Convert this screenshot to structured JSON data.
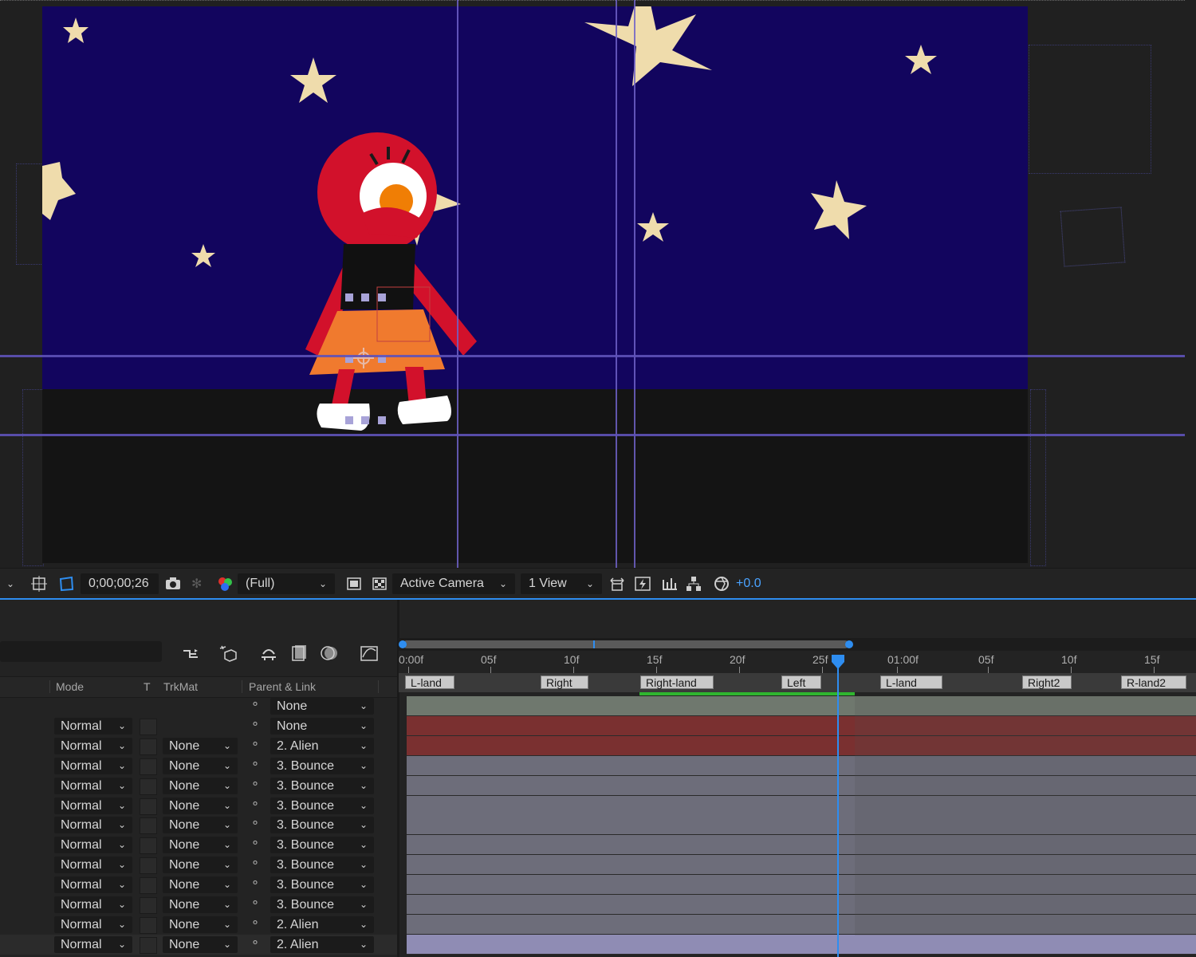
{
  "viewer": {
    "timecode": "0;00;00;26",
    "resolution": "(Full)",
    "camera": "Active Camera",
    "views": "1 View",
    "exposure": "+0.0",
    "colors": {
      "sky": "#12055e",
      "star": "#efdcac",
      "alien_body": "#d2112b",
      "skirt": "#f07a2e",
      "guide": "#6f62c8"
    },
    "toolbar_icons": [
      "chevron-down-icon",
      "region-of-interest-icon",
      "transparency-grid-icon",
      "snapshot-camera-icon",
      "show-snapshot-icon",
      "color-channels-icon",
      "fast-previews-icon",
      "toggle-mask-icon",
      "checkerboard-icon",
      "draft-3d-icon",
      "motion-blur-icon",
      "flowchart-icon",
      "reset-exposure-icon"
    ]
  },
  "timeline": {
    "columns": {
      "mode": "Mode",
      "t": "T",
      "trkmat": "TrkMat",
      "parent": "Parent & Link"
    },
    "tool_icons": [
      "shy-layers-icon",
      "comp-marker-icon",
      "frame-blending-icon",
      "draft-3d-icon",
      "motion-blur-icon",
      "graph-editor-icon"
    ],
    "ruler_labels": [
      "0:00f",
      "05f",
      "10f",
      "15f",
      "20f",
      "25f",
      "01:00f",
      "05f",
      "10f",
      "15f"
    ],
    "markers": [
      "L-land",
      "Right",
      "Right-land",
      "Left",
      "L-land",
      "Right2",
      "R-land2"
    ],
    "layers": [
      {
        "mode": "",
        "trkmat": "",
        "parent": "None",
        "bar": "#6f786e"
      },
      {
        "mode": "Normal",
        "trkmat": "",
        "parent": "None",
        "bar": "#7a3030"
      },
      {
        "mode": "Normal",
        "trkmat": "None",
        "parent": "2. Alien",
        "bar": "#7a3030"
      },
      {
        "mode": "Normal",
        "trkmat": "None",
        "parent": "3. Bounce",
        "bar": "#6d6d7a"
      },
      {
        "mode": "Normal",
        "trkmat": "None",
        "parent": "3. Bounce",
        "bar": "#6d6d7a"
      },
      {
        "mode": "Normal",
        "trkmat": "None",
        "parent": "3. Bounce",
        "bar": "#6d6d7a"
      },
      {
        "mode": "Normal",
        "trkmat": "None",
        "parent": "3. Bounce",
        "bar": "#6d6d7a"
      },
      {
        "mode": "Normal",
        "trkmat": "None",
        "parent": "3. Bounce",
        "bar": "#6d6d7a"
      },
      {
        "mode": "Normal",
        "trkmat": "None",
        "parent": "3. Bounce",
        "bar": "#6d6d7a"
      },
      {
        "mode": "Normal",
        "trkmat": "None",
        "parent": "3. Bounce",
        "bar": "#6d6d7a"
      },
      {
        "mode": "Normal",
        "trkmat": "None",
        "parent": "3. Bounce",
        "bar": "#6d6d7a"
      },
      {
        "mode": "Normal",
        "trkmat": "None",
        "parent": "2. Alien",
        "bar": "#6d6d7a"
      },
      {
        "mode": "Normal",
        "trkmat": "None",
        "parent": "2. Alien",
        "bar": "#8f8cb4"
      }
    ]
  }
}
